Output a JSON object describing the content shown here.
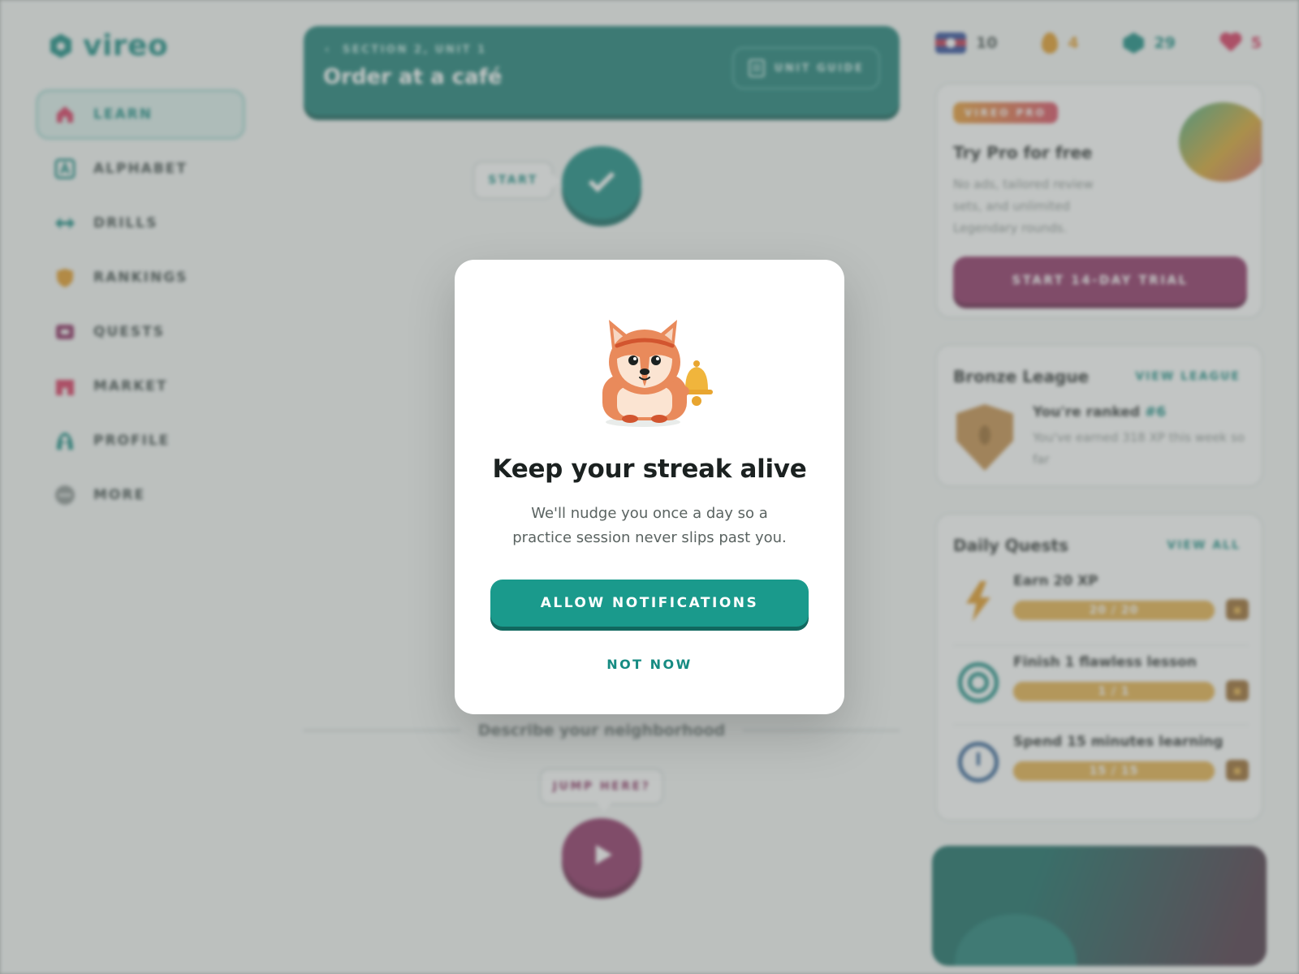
{
  "app": {
    "logo_text": "vireo",
    "brand_color": "#168b82"
  },
  "sidebar": {
    "items": [
      {
        "label": "LEARN",
        "icon": "home-icon",
        "active": true
      },
      {
        "label": "ALPHABET",
        "icon": "alphabet-icon",
        "active": false
      },
      {
        "label": "DRILLS",
        "icon": "dumbbell-icon",
        "active": false
      },
      {
        "label": "RANKINGS",
        "icon": "shield-icon",
        "active": false
      },
      {
        "label": "QUESTS",
        "icon": "chest-icon",
        "active": false
      },
      {
        "label": "MARKET",
        "icon": "store-icon",
        "active": false
      },
      {
        "label": "PROFILE",
        "icon": "user-icon",
        "active": false
      },
      {
        "label": "MORE",
        "icon": "more-icon",
        "active": false
      }
    ]
  },
  "unit": {
    "crumb": "SECTION 2, UNIT 1",
    "title": "Order at a café",
    "guide_label": "UNIT GUIDE"
  },
  "path": {
    "start_label": "START",
    "divider_text": "Describe your neighborhood",
    "jump_label": "JUMP HERE?"
  },
  "stats": {
    "course": "10",
    "streak": "4",
    "gems": "29",
    "hearts": "5"
  },
  "pro": {
    "badge": "VIREO PRO",
    "title": "Try Pro for free",
    "description": "No ads, tailored review sets, and unlimited Legendary rounds.",
    "button": "START 14-DAY TRIAL"
  },
  "league": {
    "title": "Bronze League",
    "link": "VIEW LEAGUE",
    "rank_prefix": "You're ranked ",
    "rank_value": "#6",
    "subtitle": "You've earned 318 XP this week so far"
  },
  "quests": {
    "title": "Daily Quests",
    "link": "VIEW ALL",
    "items": [
      {
        "title": "Earn 20 XP",
        "count": "20 / 20",
        "progress": 1.0,
        "icon": "lightning-icon"
      },
      {
        "title": "Finish 1 flawless lesson",
        "count": "1 / 1",
        "progress": 1.0,
        "icon": "target-icon"
      },
      {
        "title": "Spend 15 minutes learning",
        "count": "15 / 15",
        "progress": 1.0,
        "icon": "timer-icon"
      }
    ]
  },
  "modal": {
    "title": "Keep your streak alive",
    "body": "We'll nudge you once a day so a practice session never slips past you.",
    "allow_button": "ALLOW NOTIFICATIONS",
    "dismiss_button": "NOT NOW",
    "illustration": "fox-with-bell-icon"
  },
  "colors": {
    "teal": "#168b82",
    "plum": "#8e2f63",
    "gold": "#e39a26"
  }
}
